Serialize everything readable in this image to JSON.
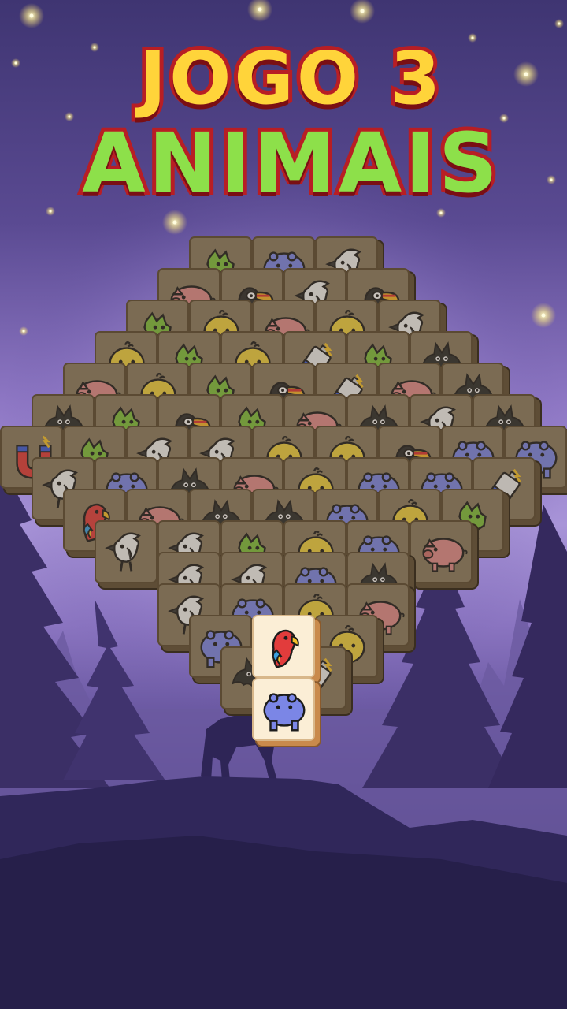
{
  "title": {
    "line1": "JOGO 3",
    "line2": "ANIMAIS"
  },
  "colors": {
    "sky_top": "#3f3572",
    "sky_glow": "#a894d8",
    "title_yellow": "#ffd43a",
    "title_green": "#8de04a",
    "title_outline": "#b81e24",
    "tile_face": "#8a7a5e",
    "tile_face_active": "#fbeed6"
  },
  "tile_types": [
    "chameleon",
    "hippo",
    "cockatoo",
    "pig",
    "toucan",
    "parrot",
    "chick",
    "bat",
    "magnet",
    "battery"
  ],
  "board": {
    "rows": [
      [
        "chameleon",
        "hippo",
        "cockatoo"
      ],
      [
        "pig",
        "toucan",
        "cockatoo",
        "toucan"
      ],
      [
        "chameleon",
        "chick",
        "pig",
        "chick",
        "cockatoo"
      ],
      [
        "chick",
        "chameleon",
        "chick",
        "battery",
        "chameleon",
        "bat"
      ],
      [
        "pig",
        "chick",
        "chameleon",
        "toucan",
        "battery",
        "pig",
        "bat"
      ],
      [
        "bat",
        "chameleon",
        "toucan",
        "chameleon",
        "pig",
        "bat",
        "cockatoo",
        "bat"
      ],
      [
        "magnet",
        "chameleon",
        "cockatoo",
        "cockatoo",
        "chick",
        "chick",
        "toucan",
        "hippo",
        "hippo"
      ],
      [
        "cockatoo",
        "hippo",
        "bat",
        "pig",
        "chick",
        "hippo",
        "hippo",
        "battery"
      ],
      [
        "parrot",
        "pig",
        "bat",
        "bat",
        "hippo",
        "chick",
        "chameleon"
      ],
      [
        "cockatoo",
        "cockatoo",
        "chameleon",
        "chick",
        "hippo",
        "pig"
      ],
      [
        "cockatoo",
        "cockatoo",
        "hippo",
        "bat"
      ],
      [
        "cockatoo",
        "hippo",
        "chick",
        "pig"
      ],
      [
        "hippo",
        "bat",
        "chick"
      ],
      [
        "bat",
        "battery"
      ]
    ],
    "active_tiles": [
      "parrot",
      "hippo"
    ]
  }
}
